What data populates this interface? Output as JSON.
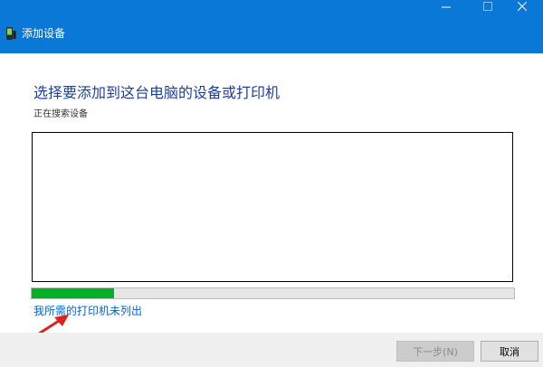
{
  "window": {
    "title": "添加设备",
    "controls": {
      "minimize_icon": "minimize-icon",
      "maximize_icon": "maximize-icon",
      "close_icon": "close-icon"
    }
  },
  "main": {
    "heading": "选择要添加到这台电脑的设备或打印机",
    "status": "正在搜索设备",
    "progress": 0.17,
    "printer_link": "我所需的打印机未列出"
  },
  "footer": {
    "next_label": "下一步(N)",
    "cancel_label": "取消"
  },
  "colors": {
    "titlebar": "#0a78d7",
    "heading": "#1e3f9a",
    "progress_fill": "#06b025",
    "link": "#0066cc",
    "annotation_arrow": "#e02020"
  }
}
